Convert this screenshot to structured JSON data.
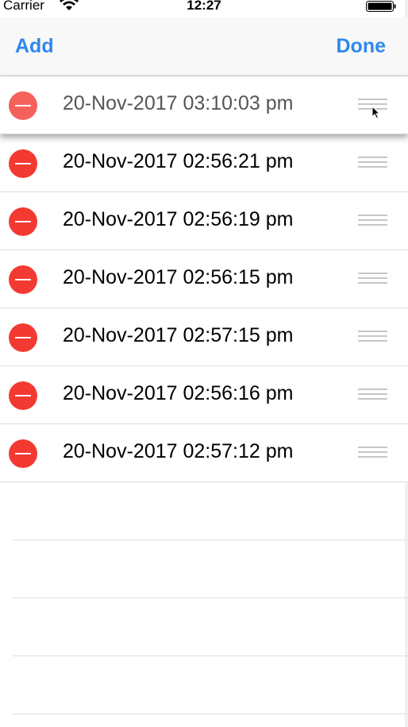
{
  "status_bar": {
    "carrier": "Carrier",
    "time": "12:27"
  },
  "nav": {
    "add_label": "Add",
    "done_label": "Done"
  },
  "rows": [
    {
      "label": "20-Nov-2017 03:10:03 pm",
      "state": "dragging"
    },
    {
      "label": "20-Nov-2017 02:56:21 pm"
    },
    {
      "label": "20-Nov-2017 02:56:19 pm"
    },
    {
      "label": "20-Nov-2017 02:56:15 pm"
    },
    {
      "label": "20-Nov-2017 02:57:15 pm"
    },
    {
      "label": "20-Nov-2017 02:56:16 pm"
    },
    {
      "label": "20-Nov-2017 02:57:12 pm"
    }
  ],
  "colors": {
    "accent": "#2f87f0",
    "delete": "#f23a32",
    "separator": "#dedee2"
  }
}
